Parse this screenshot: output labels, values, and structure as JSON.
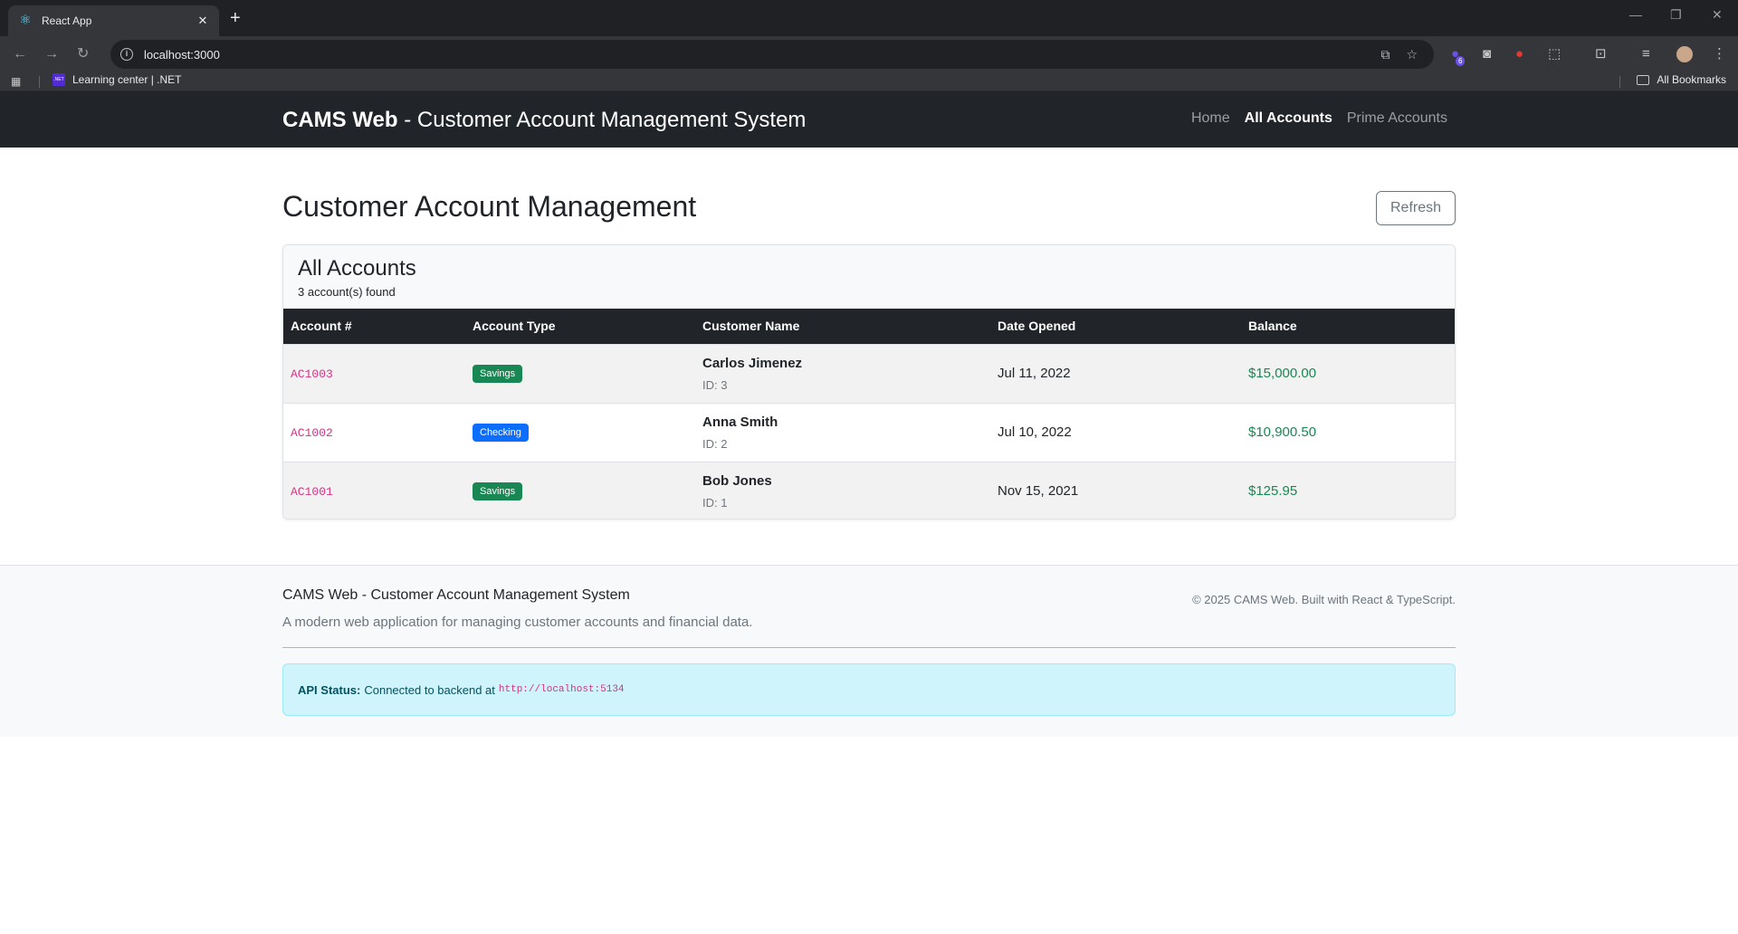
{
  "browser": {
    "tab_title": "React App",
    "url": "localhost:3000",
    "bookmark_label": "Learning center | .NET",
    "all_bookmarks_label": "All Bookmarks",
    "extension_badge": "6"
  },
  "nav": {
    "brand_bold": "CAMS Web",
    "brand_rest": " - Customer Account Management System",
    "links": [
      {
        "label": "Home",
        "active": false
      },
      {
        "label": "All Accounts",
        "active": true
      },
      {
        "label": "Prime Accounts",
        "active": false
      }
    ]
  },
  "main": {
    "title": "Customer Account Management",
    "refresh_label": "Refresh"
  },
  "card": {
    "title": "All Accounts",
    "subtitle": "3 account(s) found",
    "columns": [
      "Account #",
      "Account Type",
      "Customer Name",
      "Date Opened",
      "Balance"
    ],
    "rows": [
      {
        "account": "AC1003",
        "type": "Savings",
        "name": "Carlos Jimenez",
        "id": "ID: 3",
        "date": "Jul 11, 2022",
        "balance": "$15,000.00"
      },
      {
        "account": "AC1002",
        "type": "Checking",
        "name": "Anna Smith",
        "id": "ID: 2",
        "date": "Jul 10, 2022",
        "balance": "$10,900.50"
      },
      {
        "account": "AC1001",
        "type": "Savings",
        "name": "Bob Jones",
        "id": "ID: 1",
        "date": "Nov 15, 2021",
        "balance": "$125.95"
      }
    ]
  },
  "footer": {
    "title": "CAMS Web - Customer Account Management System",
    "description": "A modern web application for managing customer accounts and financial data.",
    "copyright": "© 2025 CAMS Web. Built with React & TypeScript.",
    "api_label": "API Status:",
    "api_text": "Connected to backend at",
    "api_url": "http://localhost:5134"
  },
  "colors": {
    "navbar": "#212529",
    "savings_badge": "#198754",
    "checking_badge": "#0d6efd",
    "balance": "#198754",
    "account_code": "#d63384",
    "alert_bg": "#cff4fc"
  }
}
